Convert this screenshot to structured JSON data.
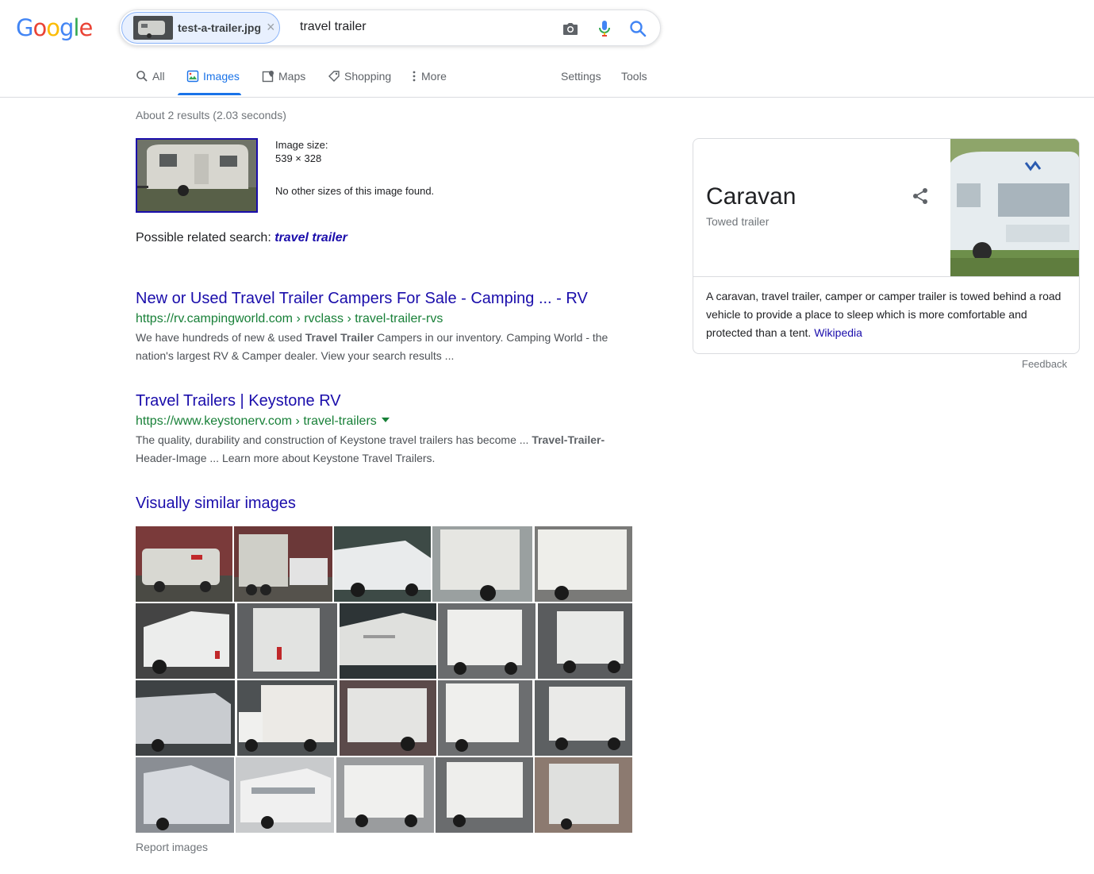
{
  "search": {
    "chip_label": "test-a-trailer.jpg",
    "chip_close": "×",
    "query": "travel trailer"
  },
  "tabs": [
    {
      "label": "All",
      "icon": "search-icon"
    },
    {
      "label": "Images",
      "icon": "image-icon",
      "active": true
    },
    {
      "label": "Maps",
      "icon": "map-icon"
    },
    {
      "label": "Shopping",
      "icon": "tag-icon"
    },
    {
      "label": "More",
      "icon": "more-vertical-icon"
    }
  ],
  "tools": {
    "settings": "Settings",
    "tools": "Tools"
  },
  "stats": "About 2 results (2.03 seconds)",
  "image_info": {
    "size_label": "Image size:",
    "size_value": "539 × 328",
    "no_sizes": "No other sizes of this image found."
  },
  "related": {
    "prefix": "Possible related search:",
    "link": "travel trailer"
  },
  "results": [
    {
      "title": "New or Used Travel Trailer Campers For Sale - Camping ... - RV",
      "url": "https://rv.campingworld.com › rvclass › travel-trailer-rvs",
      "snippet_a": "We have hundreds of new & used ",
      "snippet_bold": "Travel Trailer",
      "snippet_b": " Campers in our inventory. Camping World - the nation's largest RV & Camper dealer. View your search results ..."
    },
    {
      "title": "Travel Trailers | Keystone RV",
      "url": "https://www.keystonerv.com › travel-trailers",
      "snippet_a": "The quality, durability and construction of Keystone travel trailers has become ... ",
      "snippet_bold": "Travel-Trailer-",
      "snippet_b": "Header-Image ... Learn more about Keystone Travel Trailers."
    }
  ],
  "similar": {
    "heading": "Visually similar images",
    "report": "Report images"
  },
  "knowledge_panel": {
    "title": "Caravan",
    "subtitle": "Towed trailer",
    "description": "A caravan, travel trailer, camper or camper trailer is towed behind a road vehicle to provide a place to sleep which is more comfortable and protected than a tent. ",
    "source": "Wikipedia",
    "feedback": "Feedback"
  },
  "colors": {
    "link": "#1a0dab",
    "url_green": "#188038",
    "active_tab": "#1a73e8"
  }
}
